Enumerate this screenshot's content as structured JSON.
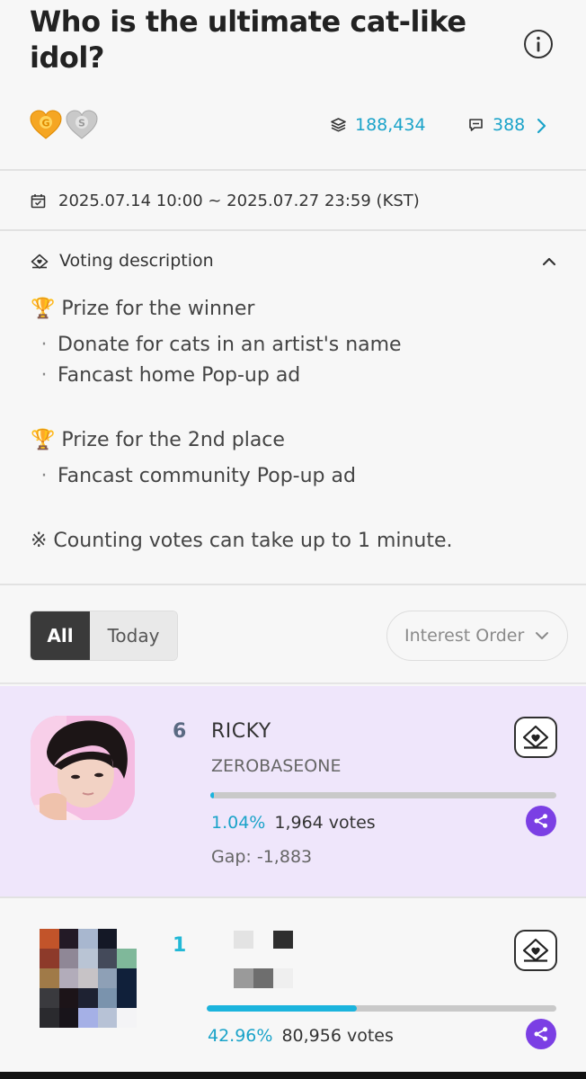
{
  "poll": {
    "title": "Who is the ultimate cat-like idol?",
    "total_votes": "188,434",
    "comments": "388",
    "period": "2025.07.14 10:00 ~ 2025.07.27 23:59 (KST)"
  },
  "description": {
    "header": "Voting description",
    "lines": {
      "winner_title": "🏆 Prize for the winner",
      "winner_1": "Donate for cats in an artist's name",
      "winner_2": "Fancast home Pop-up ad",
      "second_title": "🏆 Prize for the 2nd place",
      "second_1": "Fancast community Pop-up ad",
      "note": "※ Counting votes can take up to 1 minute."
    },
    "bullet": "·"
  },
  "filters": {
    "tab_all": "All",
    "tab_today": "Today",
    "order_selected": "Interest Order"
  },
  "entries": {
    "ricky": {
      "rank": "6",
      "name": "RICKY",
      "group": "ZEROBASEONE",
      "percent": "1.04%",
      "votes": "1,964 votes",
      "gap": "Gap: -1,883",
      "progress": 0.0104
    },
    "first": {
      "rank": "1",
      "percent": "42.96%",
      "votes": "80,956 votes",
      "progress": 0.4296
    }
  },
  "colors": {
    "accent": "#1aa3c9",
    "highlight_card": "#efe6fb",
    "share_button": "#7b3fe4",
    "rank_six": "#5a6a82",
    "rank_one": "#22b8d6"
  },
  "icons": {
    "info": "info-circle-icon",
    "gold_heart": "gold-heart-icon",
    "silver_heart": "silver-heart-icon",
    "votes": "stack-icon",
    "comments": "comment-icon",
    "calendar": "calendar-icon",
    "vote": "vote-box-icon",
    "share": "share-icon"
  }
}
